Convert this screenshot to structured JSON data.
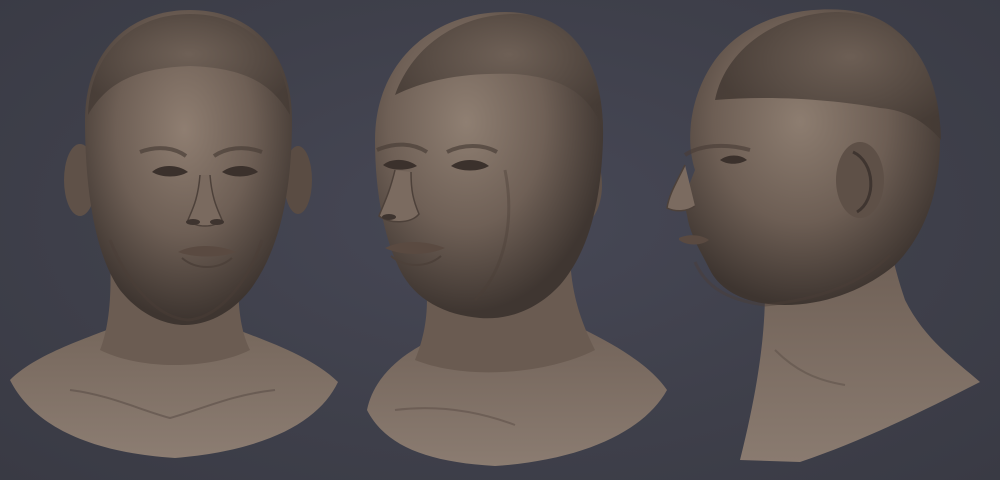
{
  "scene": {
    "background_color": "#3e3f4a",
    "material_color": "#8a7a6e",
    "views": [
      {
        "name": "front",
        "description_icon": "head-front-view"
      },
      {
        "name": "three-quarter",
        "description_icon": "head-three-quarter-view"
      },
      {
        "name": "profile",
        "description_icon": "head-profile-view"
      }
    ]
  }
}
